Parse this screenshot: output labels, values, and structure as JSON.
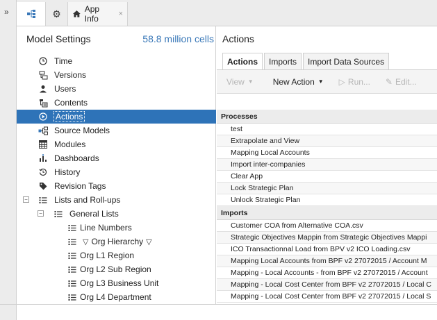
{
  "window": {
    "tabs": [
      {
        "icon": "model-structure-icon"
      },
      {
        "icon": "gear-icon"
      },
      {
        "icon": "home-icon",
        "label": "App Info",
        "close_icon": "close-icon"
      }
    ],
    "expand_icon": "double-chevron-right-icon"
  },
  "model_settings": {
    "title": "Model Settings",
    "cell_count": "58.8 million cells",
    "tree": [
      {
        "label": "Time",
        "icon": "clock-icon",
        "level": 0
      },
      {
        "label": "Versions",
        "icon": "versions-icon",
        "level": 0
      },
      {
        "label": "Users",
        "icon": "user-icon",
        "level": 0
      },
      {
        "label": "Contents",
        "icon": "contents-icon",
        "level": 0
      },
      {
        "label": "Actions",
        "icon": "play-icon",
        "level": 0,
        "selected": true
      },
      {
        "label": "Source Models",
        "icon": "source-models-icon",
        "level": 0
      },
      {
        "label": "Modules",
        "icon": "grid-icon",
        "level": 0
      },
      {
        "label": "Dashboards",
        "icon": "dashboard-icon",
        "level": 0
      },
      {
        "label": "History",
        "icon": "history-icon",
        "level": 0
      },
      {
        "label": "Revision Tags",
        "icon": "tag-icon",
        "level": 0
      },
      {
        "label": "Lists and Roll-ups",
        "icon": "list-icon",
        "level": 0,
        "toggle": "−"
      },
      {
        "label": "General Lists",
        "icon": "list-icon",
        "level": 1,
        "toggle": "−"
      },
      {
        "label": "Line Numbers",
        "icon": "list-icon",
        "level": 2
      },
      {
        "label": "Org Hierarchy",
        "icon": "list-icon",
        "level": 2,
        "triangles": true
      },
      {
        "label": "Org L1 Region",
        "icon": "list-icon",
        "level": 2
      },
      {
        "label": "Org L2 Sub Region",
        "icon": "list-icon",
        "level": 2
      },
      {
        "label": "Org L3 Business Unit",
        "icon": "list-icon",
        "level": 2
      },
      {
        "label": "Org L4 Department",
        "icon": "list-icon",
        "level": 2
      }
    ]
  },
  "actions_panel": {
    "title": "Actions",
    "subtabs": [
      {
        "label": "Actions",
        "active": true
      },
      {
        "label": "Imports",
        "active": false
      },
      {
        "label": "Import Data Sources",
        "active": false
      }
    ],
    "toolbar": {
      "view": "View",
      "new_action": "New Action",
      "run": "Run...",
      "edit": "Edit..."
    },
    "groups": [
      {
        "name": "Processes",
        "items": [
          "test",
          "Extrapolate and View",
          "Mapping Local Accounts",
          "Import inter-companies",
          "Clear App",
          "Lock Strategic Plan",
          "Unlock Strategic Plan"
        ]
      },
      {
        "name": "Imports",
        "items": [
          "Customer COA from Alternative COA.csv",
          "Strategic Objectives Mappin from Strategic Objectives Mappi",
          "ICO Transactionnal Load from BPV v2 ICO Loading.csv",
          "Mapping Local Accounts from BPF v2 27072015 / Account M",
          "Mapping - Local Accounts - from BPF v2 27072015 / Account",
          "Mapping - Local Cost Center from BPF v2 27072015 / Local C",
          "Mapping - Local Cost Center from BPF v2 27072015 / Local S"
        ]
      }
    ]
  }
}
